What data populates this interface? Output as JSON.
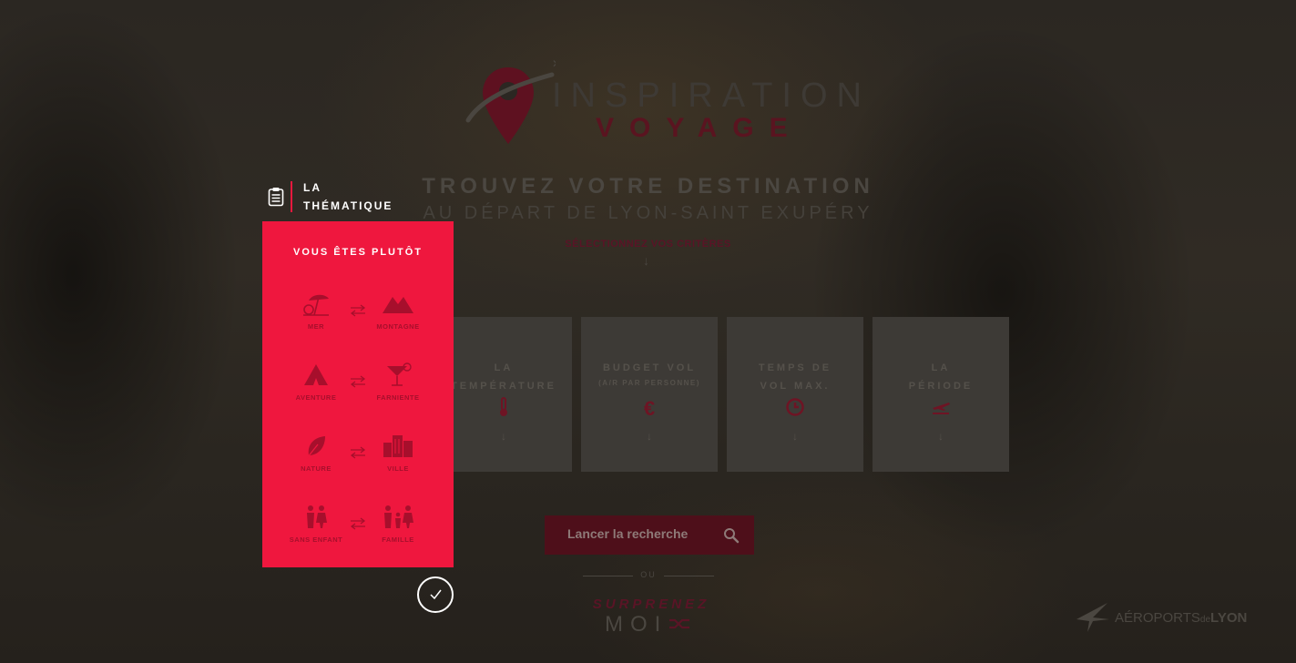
{
  "logo": {
    "word1": "INSPIRATION",
    "word2": "VOYAGE"
  },
  "headline": "TROUVEZ VOTRE DESTINATION",
  "subheadline": "AU DÉPART DE LYON-SAINT EXUPÉRY",
  "criteria_prompt": "SÉLECTIONNEZ VOS CRITÈRES",
  "arrow_glyph": "↓",
  "active_criterion": {
    "label_line1": "LA",
    "label_line2": "THÉMATIQUE",
    "icon": "clipboard-icon"
  },
  "panel": {
    "title": "VOUS ÊTES PLUTÔT",
    "pairs": [
      {
        "left": "MER",
        "right": "MONTAGNE"
      },
      {
        "left": "AVENTURE",
        "right": "FARNIENTE"
      },
      {
        "left": "NATURE",
        "right": "VILLE"
      },
      {
        "left": "SANS ENFANT",
        "right": "FAMILLE"
      }
    ],
    "color": "#ef173e"
  },
  "cards": [
    {
      "label": "LA\nTEMPÉRATURE",
      "sub": "",
      "icon_name": "thermometer-icon",
      "icon": "🌡"
    },
    {
      "label": "BUDGET VOL",
      "sub": "(A/R PAR PERSONNE)",
      "icon_name": "euro-icon",
      "icon": "€"
    },
    {
      "label": "TEMPS DE\nVOL MAX.",
      "sub": "",
      "icon_name": "clock-icon",
      "icon": "◷"
    },
    {
      "label": "LA\nPÉRIODE",
      "sub": "",
      "icon_name": "plane-icon",
      "icon": "✈"
    }
  ],
  "search": {
    "label": "Lancer la recherche"
  },
  "or_text": "OU",
  "surprise": {
    "line1": "SURPRENEZ",
    "line2": "MOI"
  },
  "footer_logo": {
    "part1": "AÉROPORTS",
    "part2": "de",
    "part3": "LYON"
  },
  "colors": {
    "accent": "#ef173e",
    "dark_accent": "#5a1426",
    "background": "#2b2722"
  }
}
